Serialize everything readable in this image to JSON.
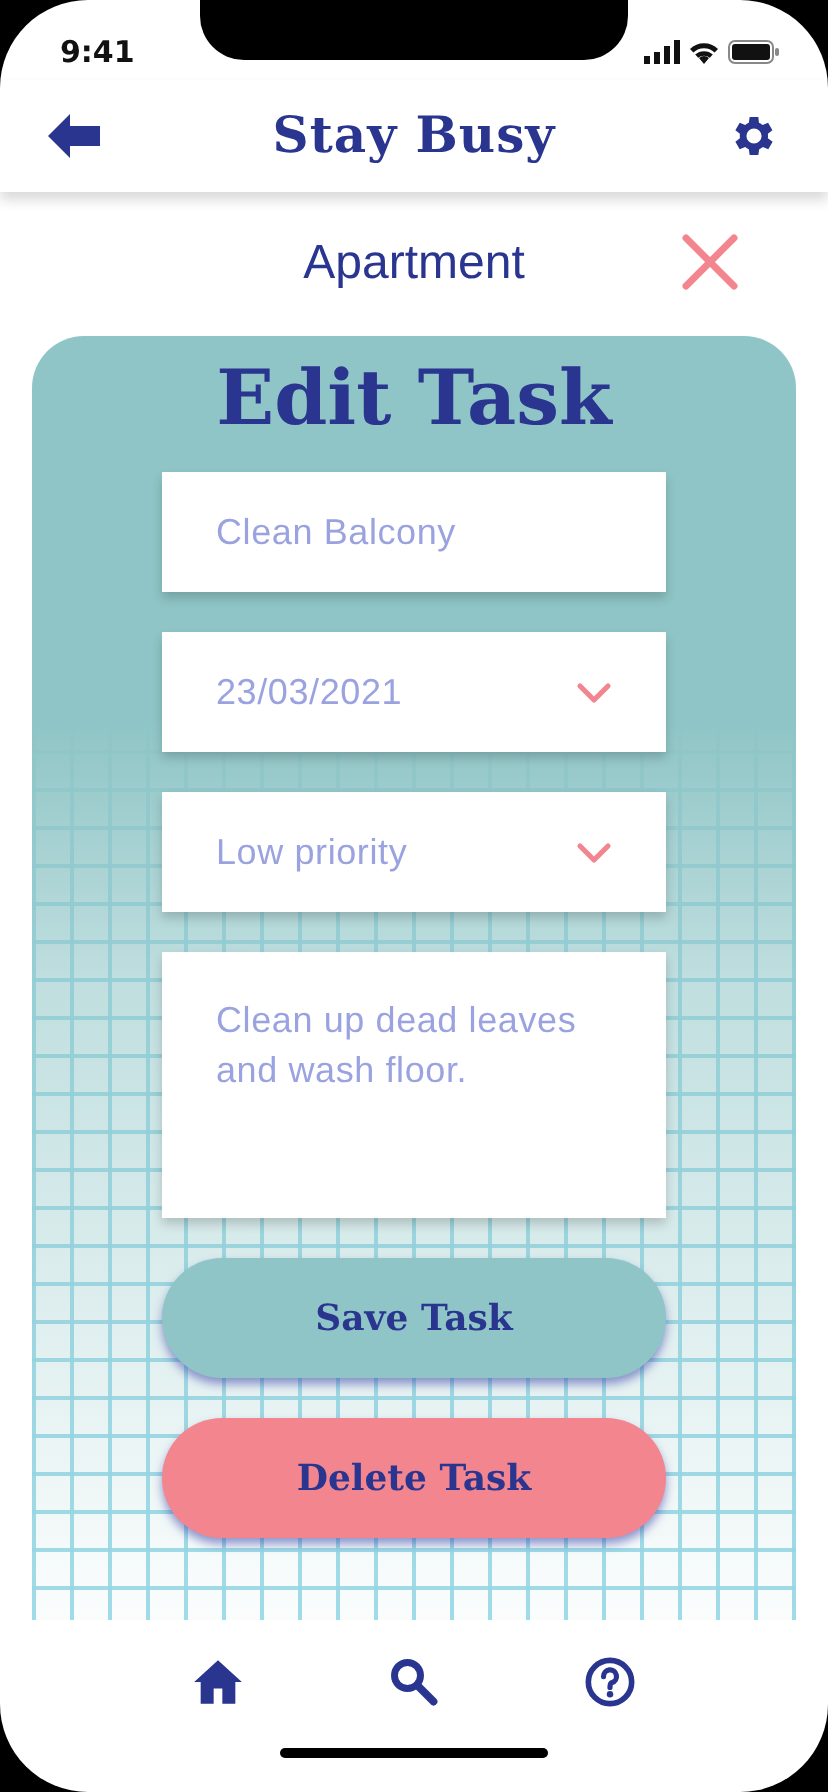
{
  "status_bar": {
    "time": "9:41"
  },
  "header": {
    "title": "Stay Busy"
  },
  "list_name": "Apartment",
  "form": {
    "title": "Edit Task",
    "fields": [
      {
        "kind": "text",
        "value": "Clean Balcony"
      },
      {
        "kind": "select",
        "value": "23/03/2021"
      },
      {
        "kind": "select",
        "value": "Low priority"
      },
      {
        "kind": "textarea",
        "value": "Clean up dead leaves and wash floor."
      }
    ],
    "buttons": [
      {
        "kind": "save",
        "label": "Save Task"
      },
      {
        "kind": "delete",
        "label": "Delete Task"
      }
    ]
  },
  "bottom_nav": {
    "items": [
      {
        "kind": "home"
      },
      {
        "kind": "search"
      },
      {
        "kind": "help"
      }
    ]
  }
}
